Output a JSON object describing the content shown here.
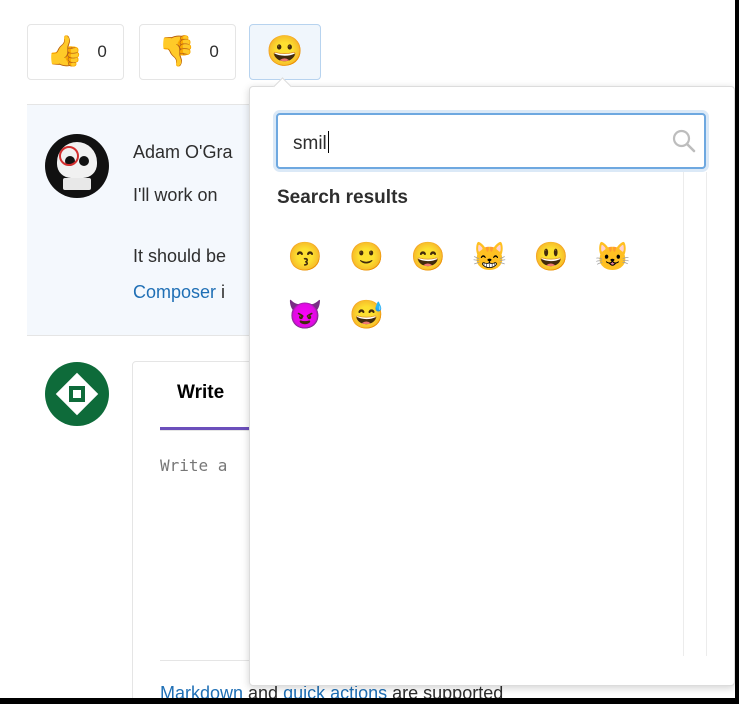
{
  "awards": {
    "thumbs_up": {
      "emoji": "👍",
      "count": "0"
    },
    "thumbs_down": {
      "emoji": "👎",
      "count": "0"
    },
    "add_reaction": {
      "emoji": "😀"
    }
  },
  "note": {
    "author": "Adam O'Gra",
    "line1": "I'll work on",
    "line2": "It should be",
    "link_text": "Composer",
    "link_tail": " i"
  },
  "editor": {
    "tab_write": "Write",
    "placeholder": "Write a",
    "footer_link1": "Markdown",
    "footer_mid": " and ",
    "footer_link2": "quick actions",
    "footer_tail": " are supported"
  },
  "emoji_menu": {
    "search_value": "smil",
    "results_title": "Search results",
    "results": [
      {
        "emoji": "😙",
        "name": "kissing-smiling-eyes"
      },
      {
        "emoji": "🙂",
        "name": "slightly-smiling"
      },
      {
        "emoji": "😄",
        "name": "smile"
      },
      {
        "emoji": "😸",
        "name": "smile-cat"
      },
      {
        "emoji": "😃",
        "name": "smiley"
      },
      {
        "emoji": "😺",
        "name": "smiley-cat"
      },
      {
        "emoji": "😈",
        "name": "smiling-imp"
      },
      {
        "emoji": "😅",
        "name": "sweat-smile"
      }
    ]
  },
  "colors": {
    "accent": "#6b4fbb",
    "link": "#1f6fb5",
    "focus": "#6ea8e0"
  }
}
